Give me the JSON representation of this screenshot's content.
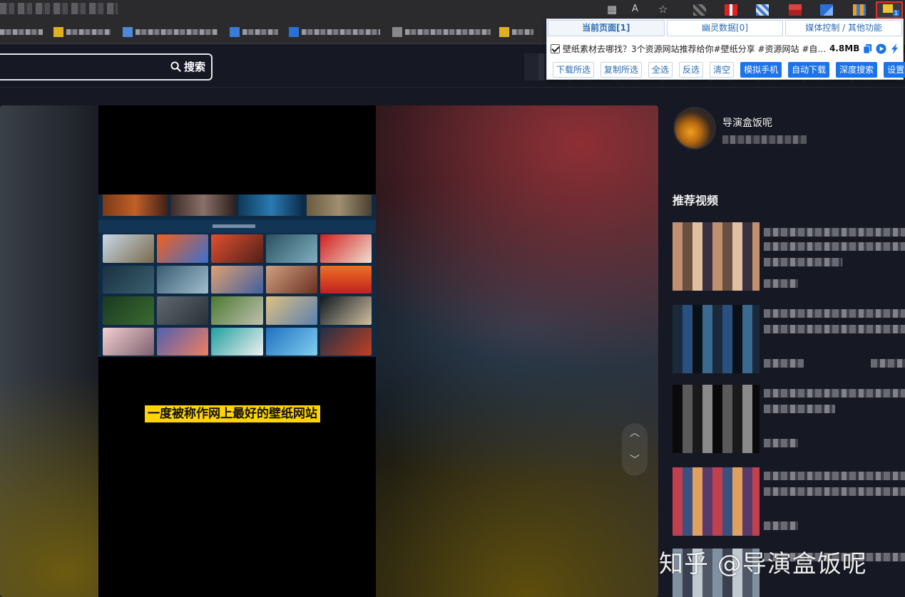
{
  "extension_popup": {
    "tabs": [
      {
        "label": "当前页面[1]"
      },
      {
        "label": "幽灵数据[0]"
      },
      {
        "label": "媒体控制 / 其他功能"
      }
    ],
    "media_item": {
      "title": "壁纸素材去哪找？3个资源网站推荐给你#壁纸分享 #资源网站 #自媒体…",
      "size": "4.8MB",
      "checked": true
    },
    "buttons": [
      {
        "label": "下载所选",
        "style": "outline"
      },
      {
        "label": "复制所选",
        "style": "outline"
      },
      {
        "label": "全选",
        "style": "outline"
      },
      {
        "label": "反选",
        "style": "outline"
      },
      {
        "label": "清空",
        "style": "outline"
      },
      {
        "label": "模拟手机",
        "style": "primary"
      },
      {
        "label": "自动下载",
        "style": "primary"
      },
      {
        "label": "深度搜索",
        "style": "primary"
      },
      {
        "label": "设置",
        "style": "primary"
      }
    ],
    "badge_count": "1"
  },
  "search": {
    "button_label": "搜索"
  },
  "video": {
    "caption": "一度被称作网上最好的壁纸网站"
  },
  "author": {
    "name": "导演盒饭呢"
  },
  "recommend": {
    "title": "推荐视频"
  },
  "watermark": "知乎 @导演盒饭呢",
  "colors": {
    "page_bg": "#161823",
    "accent_blue": "#1a73e8",
    "caption_bg": "#ffd400",
    "highlight_red": "#dd3333"
  },
  "icons": [
    "search-icon",
    "chevron-up-icon",
    "chevron-down-icon",
    "copy-icon",
    "play-icon",
    "lightning-icon",
    "reader-mode-icon",
    "read-aloud-icon",
    "favorite-icon"
  ]
}
